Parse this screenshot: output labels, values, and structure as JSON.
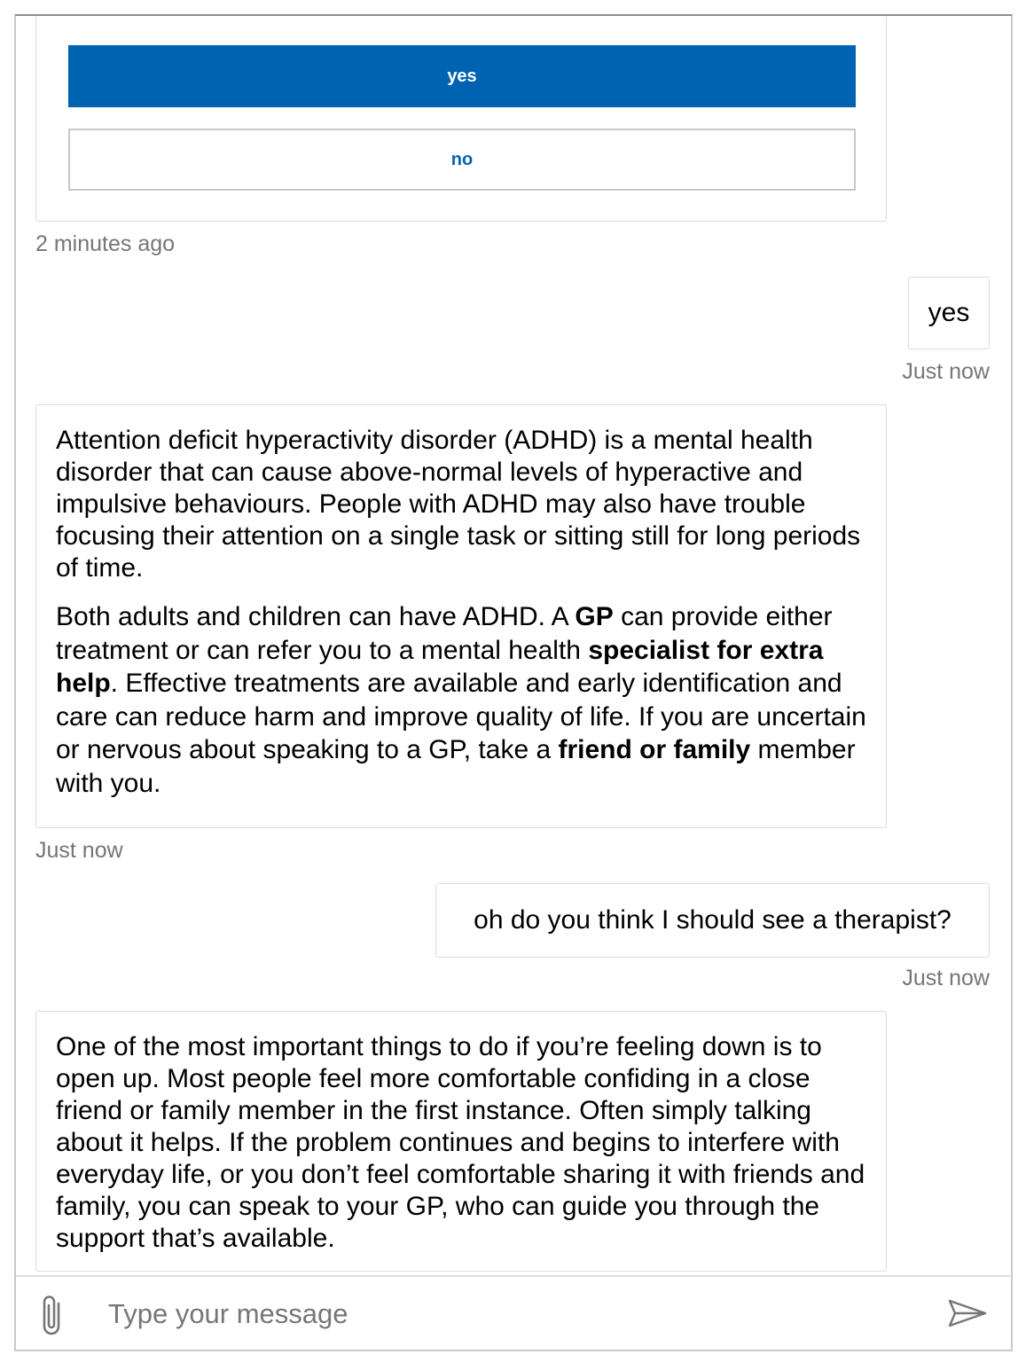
{
  "card": {
    "yes_label": "yes",
    "no_label": "no",
    "timestamp": "2 minutes ago"
  },
  "messages": [
    {
      "from": "user",
      "text": "yes",
      "timestamp": "Just now"
    },
    {
      "from": "bot",
      "paragraph1": "Attention deficit hyperactivity disorder (ADHD) is a mental health disorder that can cause above-normal levels of hyperactive and impulsive behaviours. People with ADHD may also have trouble focusing their attention on a single task or sitting still for long periods of time.",
      "p2_a": "Both adults and children can have ADHD. A ",
      "p2_b": "GP",
      "p2_c": " can provide either treatment or can refer you to a mental health ",
      "p2_d": "specialist for extra help",
      "p2_e": ". Effective treatments are available and early identification and care can reduce harm and improve quality of life. If you are uncertain or nervous about speaking to a GP, take a ",
      "p2_f": "friend or family",
      "p2_g": " member with you.",
      "timestamp": "Just now"
    },
    {
      "from": "user",
      "text": "oh do you think I should see a therapist?",
      "timestamp": "Just now"
    },
    {
      "from": "bot",
      "paragraph1": "One of the most important things to do if you’re feeling down is to open up. Most people feel more comfortable confiding in a close friend or family member in the first instance. Often simply talking about it helps. If the problem continues and begins to interfere with everyday life, or you don’t feel comfortable sharing it with friends and family, you can speak to your GP, who can guide you through the support that’s available."
    }
  ],
  "composer": {
    "placeholder": "Type your message",
    "value": "",
    "attach_icon": "paperclip-icon",
    "send_icon": "send-icon"
  },
  "colors": {
    "accent": "#0063b1",
    "timestamp": "#767676",
    "border": "#dddddd"
  }
}
